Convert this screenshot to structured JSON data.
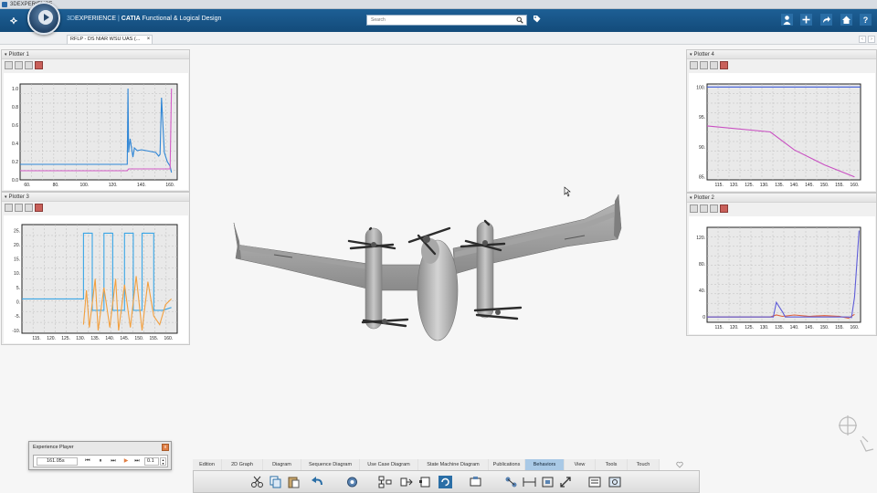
{
  "window": {
    "title": "3DEXPERIENCE"
  },
  "header": {
    "brand_3d": "3D",
    "brand_exp": "EXPERIENCE",
    "separator": " | ",
    "brand_catia": "CATIA",
    "app_name": " Functional & Logical Design",
    "search_placeholder": "Search"
  },
  "tab": {
    "label": "RFLP - DS NIAR WSU UAS (...",
    "close": "×"
  },
  "nav": {
    "left": "‹",
    "right": "›"
  },
  "plotters": [
    {
      "id": "p1",
      "title": "Plotter 1",
      "chart_data": {
        "type": "line",
        "xlim": [
          55,
          165
        ],
        "ylim": [
          0,
          1.05
        ],
        "x_ticks": [
          "60.",
          "80.",
          "100.",
          "120.",
          "140.",
          "160."
        ],
        "y_ticks": [
          "1.0",
          "0.8",
          "0.6",
          "0.4",
          "0.2",
          "0.0"
        ],
        "x_tick_values": [
          60,
          80,
          100,
          120,
          140,
          160
        ],
        "y_tick_values": [
          1.0,
          0.8,
          0.6,
          0.4,
          0.2,
          0.0
        ],
        "series": [
          {
            "color": "#2f86d6",
            "x": [
              55,
              130,
              130.5,
              131,
              132,
              134,
              135,
              137,
              140,
              150,
              152,
              153,
              154,
              156,
              158,
              160,
              161
            ],
            "y": [
              0.17,
              0.17,
              1.0,
              0.3,
              0.45,
              0.25,
              0.35,
              0.32,
              0.33,
              0.3,
              0.26,
              0.28,
              0.9,
              0.3,
              0.2,
              0.15,
              0.08
            ]
          },
          {
            "color": "#d45cc6",
            "x": [
              55,
              130,
              131,
              160,
              161
            ],
            "y": [
              0.1,
              0.1,
              0.12,
              0.12,
              1.0
            ]
          }
        ]
      }
    },
    {
      "id": "p3",
      "title": "Plotter 3",
      "chart_data": {
        "type": "line",
        "xlim": [
          110,
          163
        ],
        "ylim": [
          -11,
          27
        ],
        "x_ticks": [
          "115.",
          "120.",
          "125.",
          "130.",
          "135.",
          "140.",
          "145.",
          "150.",
          "155.",
          "160."
        ],
        "y_ticks": [
          "25.",
          "20.",
          "15.",
          "10.",
          "5.",
          "0.",
          "-5.",
          "-10."
        ],
        "x_tick_values": [
          115,
          120,
          125,
          130,
          135,
          140,
          145,
          150,
          155,
          160
        ],
        "y_tick_values": [
          25,
          20,
          15,
          10,
          5,
          0,
          -5,
          -10
        ],
        "series": [
          {
            "color": "#3aa6e6",
            "x": [
              110,
              131,
              131,
              134,
              134,
              138,
              138,
              141,
              141,
              145,
              145,
              148,
              148,
              151,
              151,
              155,
              155,
              158,
              161
            ],
            "y": [
              1,
              1,
              24,
              24,
              -3,
              -3,
              24,
              24,
              -3,
              -3,
              24,
              24,
              -3,
              -3,
              24,
              24,
              -3,
              -3,
              -2
            ]
          },
          {
            "color": "#f2a040",
            "x": [
              131,
              132,
              133,
              135,
              136,
              138,
              140,
              142,
              143,
              145,
              147,
              149,
              151,
              153,
              155,
              157,
              159,
              161
            ],
            "y": [
              -8,
              4,
              -9,
              8,
              -10,
              5,
              -9,
              8,
              -10,
              6,
              -9,
              9,
              -10,
              7,
              -5,
              -8,
              -1,
              1
            ]
          }
        ]
      }
    },
    {
      "id": "p4",
      "title": "Plotter 4",
      "chart_data": {
        "type": "line",
        "xlim": [
          111,
          162
        ],
        "ylim": [
          84.5,
          100.5
        ],
        "x_ticks": [
          "115.",
          "120.",
          "125.",
          "130.",
          "135.",
          "140.",
          "145.",
          "150.",
          "155.",
          "160."
        ],
        "y_ticks": [
          "100.",
          "95.",
          "90.",
          "85."
        ],
        "x_tick_values": [
          115,
          120,
          125,
          130,
          135,
          140,
          145,
          150,
          155,
          160
        ],
        "y_tick_values": [
          100,
          95,
          90,
          85
        ],
        "series": [
          {
            "color": "#3d5ad8",
            "x": [
              111,
              162
            ],
            "y": [
              100,
              100
            ]
          },
          {
            "color": "#c94fc2",
            "x": [
              111,
              132,
              140,
              150,
              160
            ],
            "y": [
              93.5,
              92.5,
              89.5,
              87,
              85
            ]
          }
        ]
      }
    },
    {
      "id": "p2",
      "title": "Plotter 2",
      "chart_data": {
        "type": "line",
        "xlim": [
          111,
          162
        ],
        "ylim": [
          -8,
          135
        ],
        "x_ticks": [
          "115.",
          "120.",
          "125.",
          "130.",
          "135.",
          "140.",
          "145.",
          "150.",
          "155.",
          "160."
        ],
        "y_ticks": [
          "120.",
          "80.",
          "40.",
          "0"
        ],
        "x_tick_values": [
          115,
          120,
          125,
          130,
          135,
          140,
          145,
          150,
          155,
          160
        ],
        "y_tick_values": [
          120,
          80,
          40,
          0
        ],
        "series": [
          {
            "color": "#e0603a",
            "x": [
              111,
              132,
              134,
              136,
              140,
              145,
              150,
              155,
              158,
              160
            ],
            "y": [
              0,
              0,
              3,
              1,
              3,
              1,
              2,
              1,
              -2,
              4
            ]
          },
          {
            "color": "#5e5cd8",
            "x": [
              111,
              133,
              134,
              136,
              137,
              158,
              159,
              160,
              161.5
            ],
            "y": [
              0,
              0,
              22,
              8,
              0,
              0,
              -1,
              30,
              130
            ]
          }
        ]
      }
    }
  ],
  "player": {
    "title": "Experience Player",
    "time": "161.05s",
    "speed": "0.1",
    "close": "x",
    "first": "⏮",
    "pause": "⏸",
    "step": "⏭",
    "play": "▶",
    "last": "⏭"
  },
  "action_tabs": [
    {
      "label": "Edition",
      "active": false
    },
    {
      "label": "2D Graph",
      "active": false
    },
    {
      "label": "Diagram",
      "active": false
    },
    {
      "label": "Sequence Diagram",
      "active": false
    },
    {
      "label": "Use Case Diagram",
      "active": false
    },
    {
      "label": "State Machine Diagram",
      "active": false
    },
    {
      "label": "Publications",
      "active": false
    },
    {
      "label": "Behaviors",
      "active": true
    },
    {
      "label": "View",
      "active": false
    },
    {
      "label": "Tools",
      "active": false
    },
    {
      "label": "Touch",
      "active": false
    }
  ],
  "colors": {
    "top_bar": "#1d5f95",
    "aircraft": "#9a9a9a",
    "active_tab": "#a9c9e6"
  }
}
